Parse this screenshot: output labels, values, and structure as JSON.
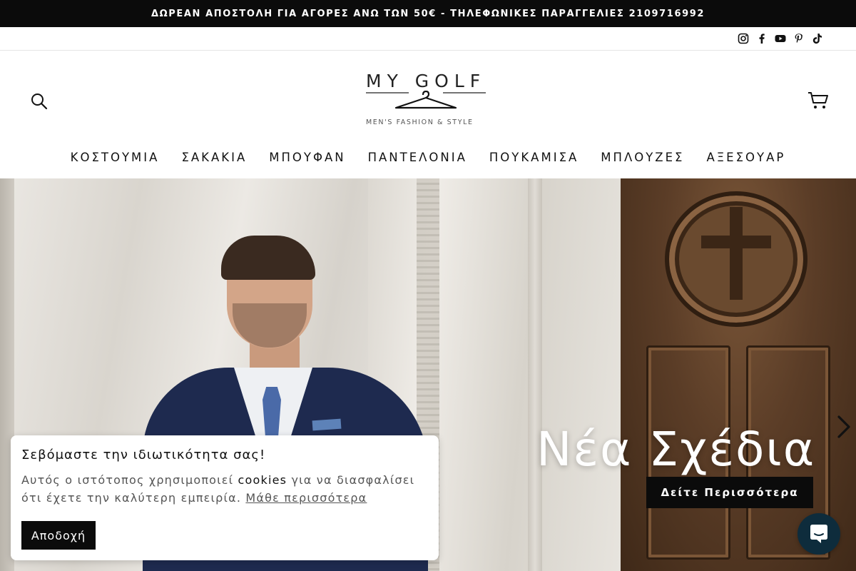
{
  "announcement": {
    "text": "ΔΩΡΕΑΝ ΑΠΟΣΤΟΛΗ ΓΙΑ ΑΓΟΡΕΣ ΑΝΩ ΤΩΝ 50€ - ΤΗΛΕΦΩΝΙΚΕΣ ΠΑΡΑΓΓΕΛΙΕΣ 2109716992"
  },
  "social": [
    "instagram-icon",
    "facebook-icon",
    "youtube-icon",
    "pinterest-icon",
    "tiktok-icon"
  ],
  "header": {
    "logo_title": "MY GOLF",
    "logo_tagline": "MEN'S FASHION & STYLE",
    "search_icon": "search-icon",
    "cart_icon": "cart-icon"
  },
  "nav": {
    "items": [
      {
        "label": "ΚΟΣΤΟΥΜΙΑ"
      },
      {
        "label": "ΣΑΚΑΚΙΑ"
      },
      {
        "label": "ΜΠΟΥΦΑΝ"
      },
      {
        "label": "ΠΑΝΤΕΛΟΝΙΑ"
      },
      {
        "label": "ΠΟΥΚΑΜΙΣΑ"
      },
      {
        "label": "ΜΠΛΟΥΖΕΣ"
      },
      {
        "label": "ΑΞΕΣΟΥΑΡ"
      }
    ]
  },
  "hero": {
    "title": "Νέα Σχέδια",
    "cta_label": "Δείτε Περισσότερα",
    "next_icon": "chevron-right-icon"
  },
  "cookie": {
    "title": "Σεβόμαστε την ιδιωτικότητα σας!",
    "text_before": "Αυτός ο ιστότοπος χρησιμοποιεί ",
    "text_strong": "cookies",
    "text_after": " για να διασφαλίσει ότι έχετε την καλύτερη εμπειρία. ",
    "link_label": "Μάθε περισσότερα",
    "accept_label": "Αποδοχή"
  },
  "chat": {
    "icon": "chat-icon"
  },
  "colors": {
    "announcement_bg": "#0b0b0b",
    "cta_bg": "#0b0b0b",
    "chat_bg": "#0e2c3c"
  }
}
